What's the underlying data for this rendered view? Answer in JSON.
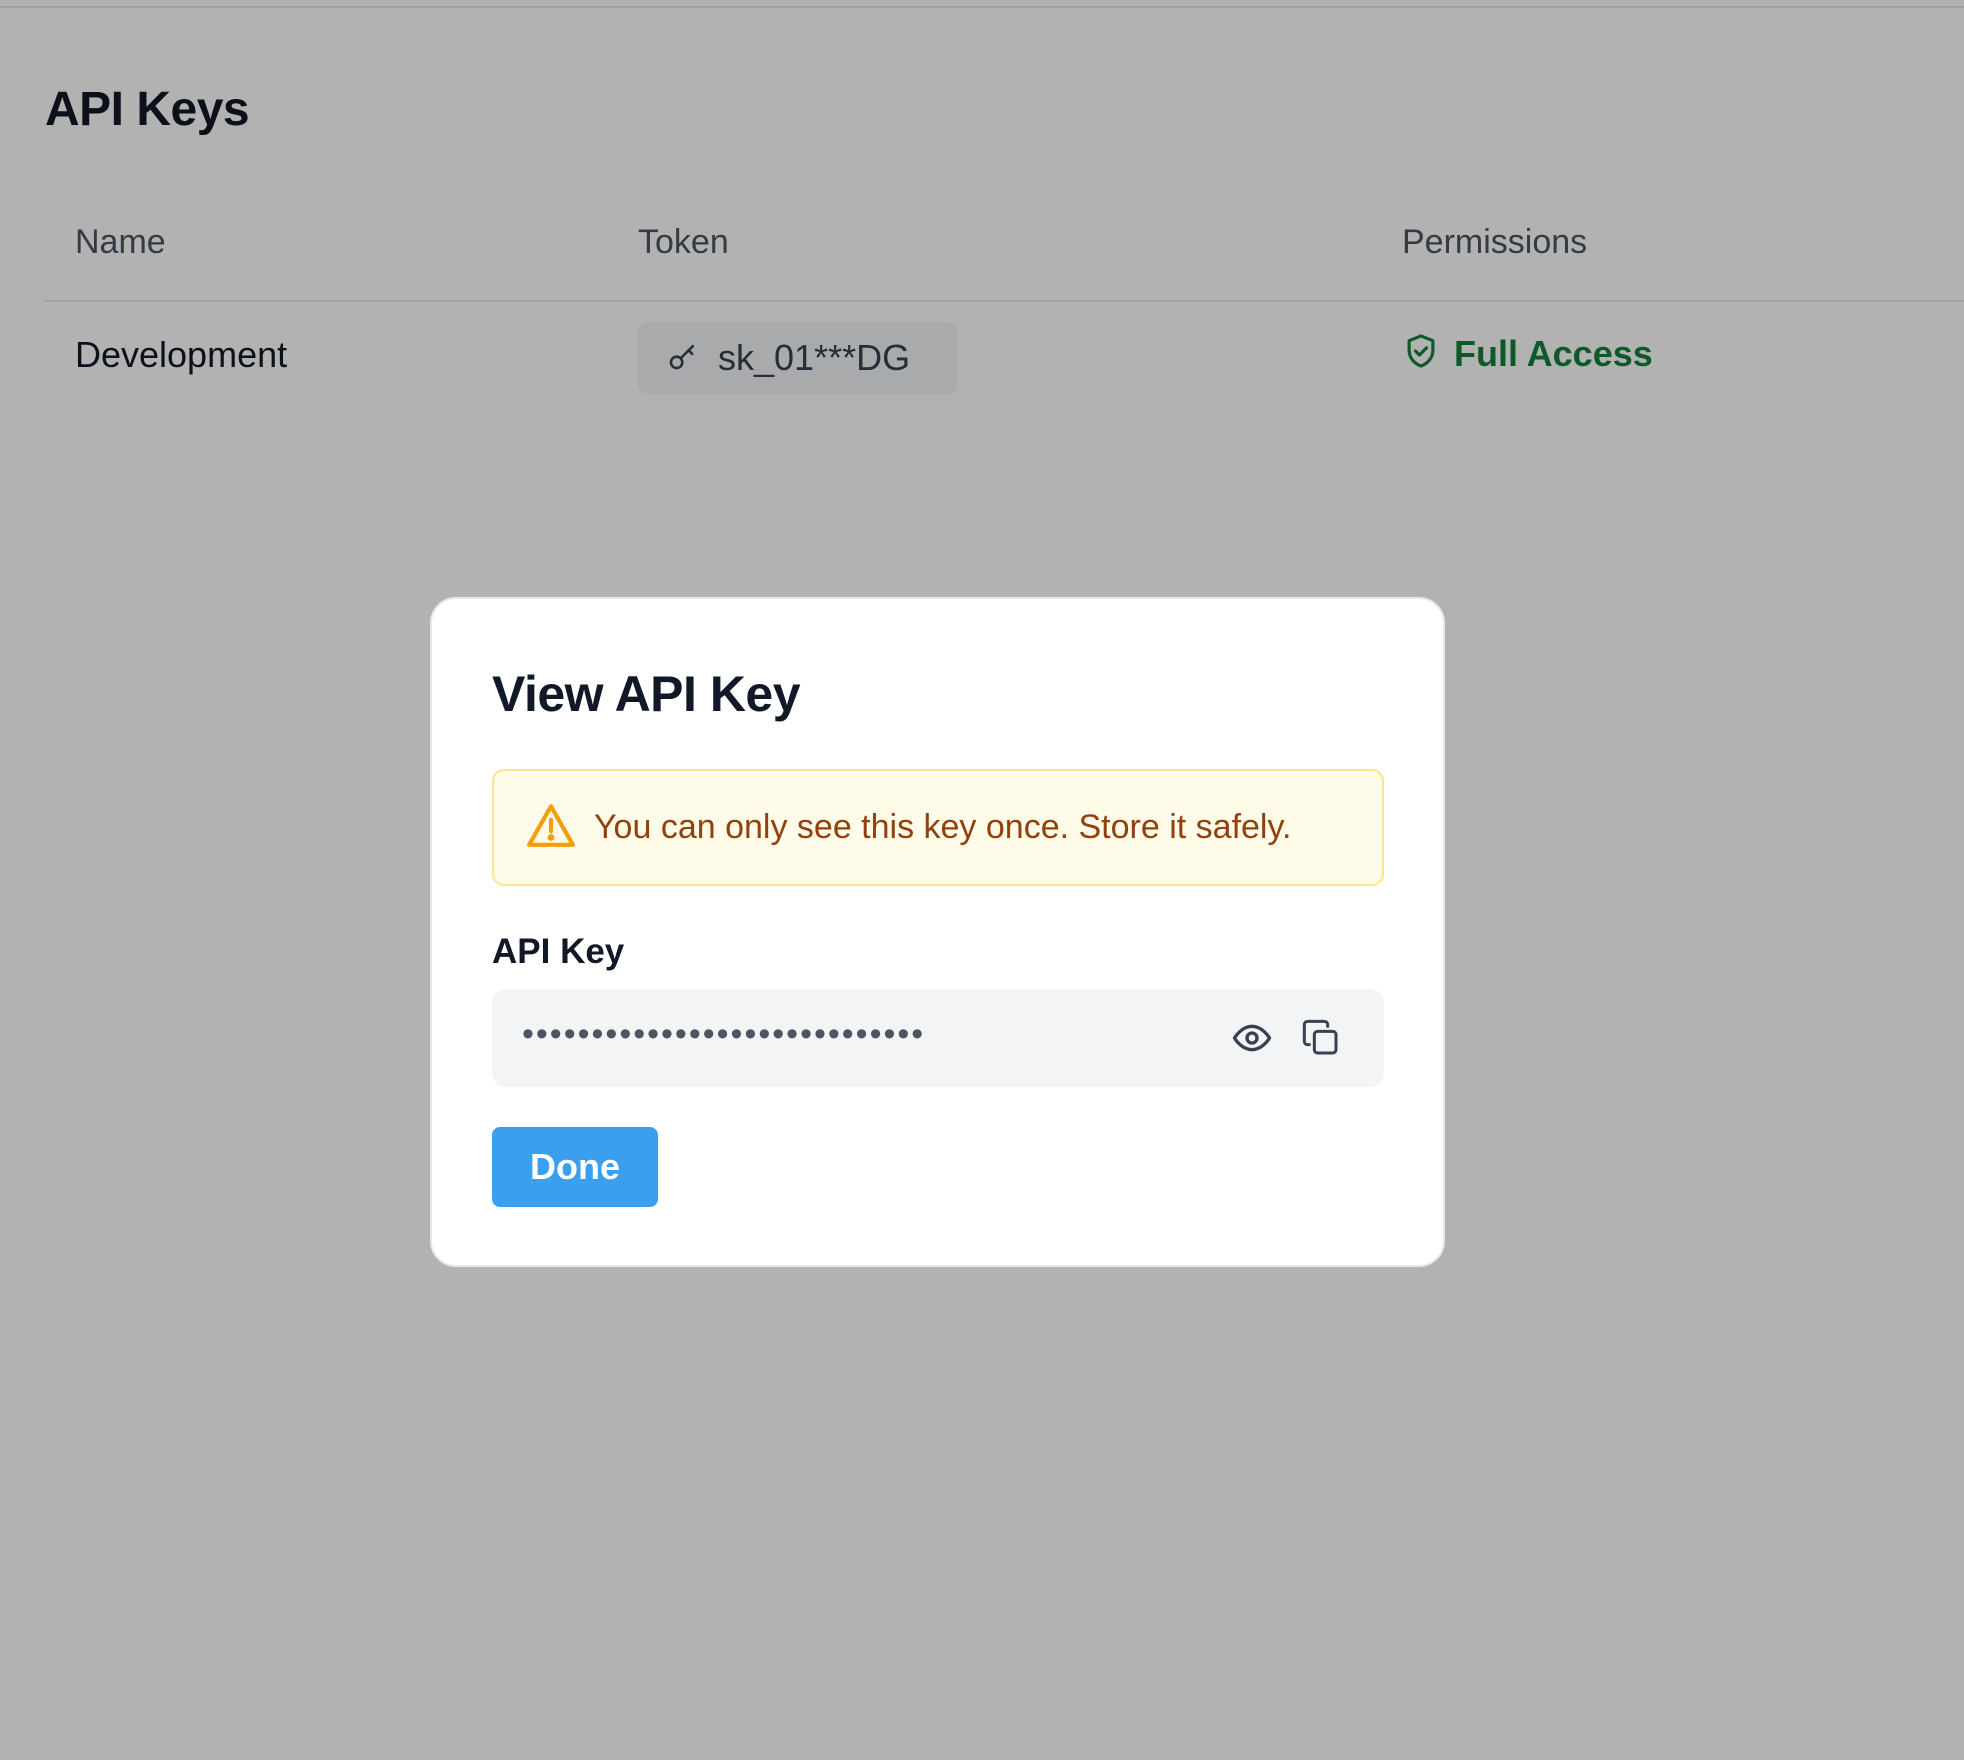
{
  "page": {
    "title": "API Keys",
    "table": {
      "headers": {
        "name": "Name",
        "token": "Token",
        "permissions": "Permissions"
      },
      "rows": [
        {
          "name": "Development",
          "token": "sk_01***DG",
          "permission": "Full Access"
        }
      ]
    }
  },
  "modal": {
    "title": "View API Key",
    "warning": "You can only see this key once. Store it safely.",
    "field_label": "API Key",
    "masked_value": "•••••••••••••••••••••••••••••",
    "done_label": "Done"
  },
  "icons": {
    "token": "key-icon",
    "permission": "shield-check-icon",
    "warning": "warning-triangle-icon",
    "show": "eye-icon",
    "copy": "copy-icon"
  },
  "colors": {
    "permission_green": "#15803d",
    "warning_text": "#92400e",
    "warning_bg": "#fefbe8",
    "primary_button": "#3b9ff0"
  }
}
